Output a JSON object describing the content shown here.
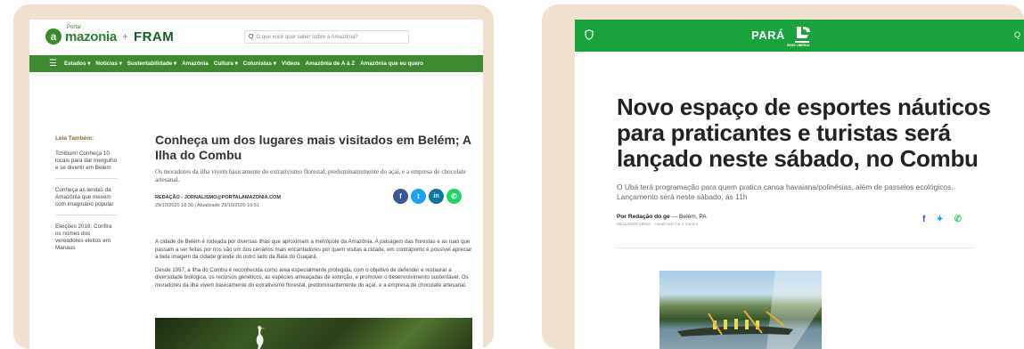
{
  "left": {
    "logo": {
      "badge": "a",
      "small": "Portal",
      "name": "mazonia",
      "separator": "+",
      "partner": "FRAM"
    },
    "search": {
      "icon": "search-icon",
      "placeholder": "O que você quer saber sobre a Amazônia?"
    },
    "nav": {
      "menu_icon": "menu-icon",
      "items": [
        "Estados ▾",
        "Notícias ▾",
        "Sustentabilidade ▾",
        "Amazônia",
        "Cultura ▾",
        "Colunistas ▾",
        "Vídeos",
        "Amazônia de A à Z",
        "Amazônia que eu quero"
      ]
    },
    "aside": {
      "title": "Leia Também:",
      "items": [
        "Tchibum! Conheça 10 locais para dar mergulho e se divertir em Belém",
        "Conheça as lendas da Amazônia que mexem com imaginário popular",
        "Eleições 2016: Confira os nomes dos vereadores eleitos em Manaus"
      ]
    },
    "article": {
      "title": "Conheça um dos lugares mais visitados em Belém; A Ilha do Combu",
      "subtitle": "Os moradores da ilha vivem basicamente do extrativismo florestal, predominantemente do açaí, e a empresa de chocolate artesanal.",
      "byline": "REDAÇÃO - JORNALISMO@PORTALAMAZONIA.COM",
      "date": "29/10/2020 18:30 | Atualizado 29/10/2020 19:51",
      "share": [
        {
          "icon": "facebook-icon",
          "glyph": "f",
          "color": "#3b5998"
        },
        {
          "icon": "twitter-icon",
          "glyph": "t",
          "color": "#1da1f2"
        },
        {
          "icon": "linkedin-icon",
          "glyph": "in",
          "color": "#0e76a8"
        },
        {
          "icon": "whatsapp-icon",
          "glyph": "✆",
          "color": "#25d366"
        }
      ],
      "paragraphs": [
        "A cidade de Belém é rodeada por diversas ilhas que aproximam a metrópole da Amazônia. A paisagem das florestas e as ruas que passam a ser feitas por rios são um dos cenários mais encantadores por quem visitas a cidade, em contraponto é possível apreciar a bela imagem da cidade grande do outro lado da Baía do Guajará.",
        "Desde 1997, a Ilha do Combu é reconhecida como área especialmente protegida, com o objetivo de defender e restaurar a diversidade biológica, os recursos genéticos, as espécies ameaçadas de extinção, e promover o desenvolvimento sustentável. Os moradores da ilha vivem basicamente do extrativismo florestal, predominantemente do açaí, e a empresa de chocolate artesanal."
      ]
    }
  },
  "right": {
    "header": {
      "shield_icon": "shield-icon",
      "section": "PARÁ",
      "network": "REDE LIBERAL",
      "search_icon": "search-icon",
      "search_glyph": "Q"
    },
    "article": {
      "title": "Novo espaço de esportes náuticos para praticantes e turistas será lançado neste sábado, no Combu",
      "subtitle": "O Ubá terá programação para quem pratica canoa havaiana/polinésias, além de passeios ecológicos. Lançamento será neste sábado, às 11h",
      "byline_author": "Por Redação do ge",
      "byline_place": "— Belém, PA",
      "date": "06/11/2020 19h01 · Atualizado há 2 meses",
      "share": [
        {
          "icon": "facebook-icon",
          "glyph": "f",
          "color": "#3b5998"
        },
        {
          "icon": "twitter-icon",
          "glyph": "✦",
          "color": "#1da1f2"
        },
        {
          "icon": "whatsapp-icon",
          "glyph": "✆",
          "color": "#25d366"
        }
      ]
    }
  }
}
